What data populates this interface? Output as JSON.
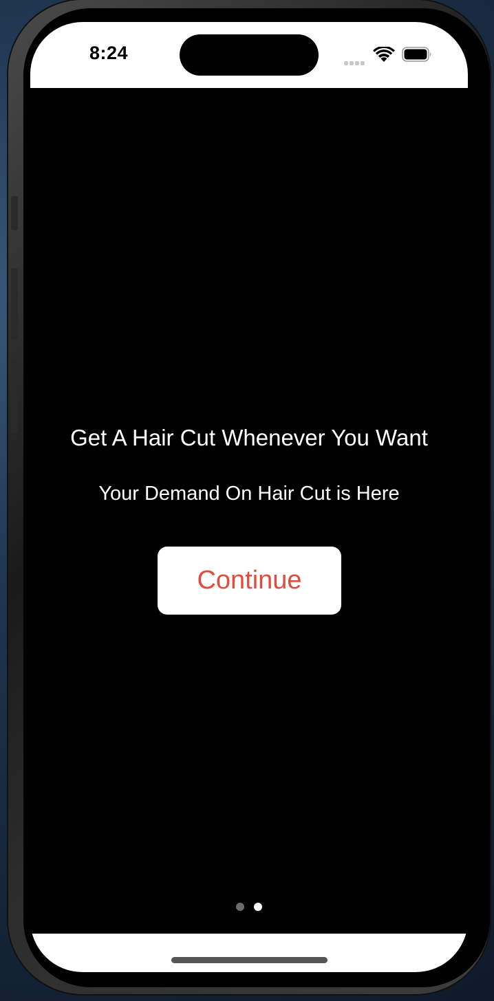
{
  "status_bar": {
    "time": "8:24",
    "wifi_icon": "wifi-icon",
    "battery_icon": "battery-icon",
    "signal_icon": "cellular-signal-icon"
  },
  "onboarding": {
    "headline": "Get A Hair Cut Whenever You Want",
    "subline": "Your Demand On Hair Cut is Here",
    "continue_label": "Continue",
    "page_count": 2,
    "current_page": 2
  },
  "colors": {
    "accent": "#e34b3c",
    "background": "#000000",
    "button_background": "#ffffff"
  }
}
